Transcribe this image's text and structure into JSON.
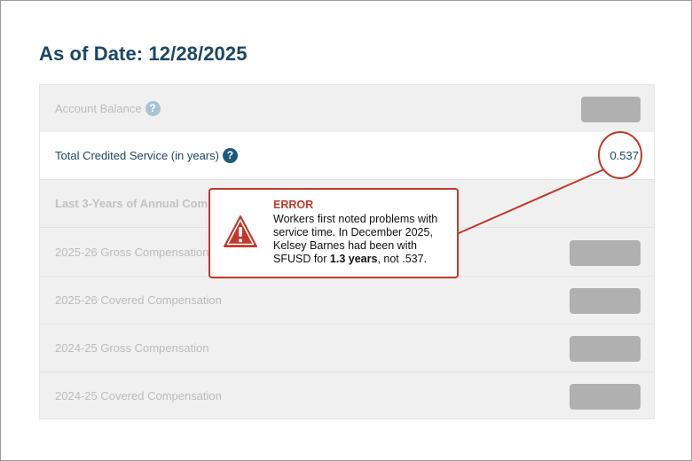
{
  "page": {
    "title": "As of Date: 12/28/2025"
  },
  "rows": {
    "account_balance": {
      "label": "Account Balance"
    },
    "credited_service": {
      "label": "Total Credited Service (in years)",
      "value": "0.537"
    },
    "annual_comp": {
      "label": "Last 3-Years of Annual Compensation"
    },
    "gross_2526": {
      "label": "2025-26 Gross Compensation"
    },
    "covered_2526": {
      "label": "2025-26 Covered Compensation"
    },
    "gross_2425": {
      "label": "2024-25 Gross Compensation"
    },
    "covered_2425": {
      "label": "2024-25 Covered Compensation"
    }
  },
  "help_icon": {
    "glyph": "?"
  },
  "error": {
    "title": "ERROR",
    "text_prefix": "Workers first noted problems with service time. In December 2025, Kelsey Barnes had been with SFUSD for ",
    "text_bold": "1.3 years",
    "text_suffix": ", not .537.",
    "icon": "warning-triangle-icon"
  },
  "colors": {
    "title": "#1c4766",
    "error_red": "#c0392b",
    "panel_bg": "#f0f0f0",
    "placeholder": "#b0b0b0"
  }
}
